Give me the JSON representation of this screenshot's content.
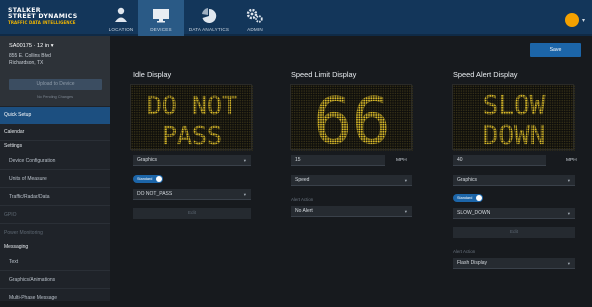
{
  "header": {
    "logo_line1": "STALKER",
    "logo_line2": "STREET DYNAMICS",
    "logo_line3": "TRAFFIC DATA INTELLIGENCE",
    "nav": [
      {
        "label": "LOCATION",
        "icon": "person-location-icon"
      },
      {
        "label": "DEVICES",
        "icon": "monitor-icon",
        "active": true
      },
      {
        "label": "DATA ANALYTICS",
        "icon": "pie-chart-icon"
      },
      {
        "label": "ADMIN",
        "icon": "gears-icon"
      }
    ]
  },
  "sidebar": {
    "device_id": "SA00175 · 12 in",
    "device_caret": "▾",
    "address_line1": "855 E. Collins Blvd",
    "address_line2": "Richardson, TX",
    "upload_label": "Upload to Device",
    "pending_label": "No Pending Changes",
    "items": [
      {
        "label": "Quick Setup",
        "type": "active"
      },
      {
        "label": "Calendar",
        "type": "section"
      },
      {
        "label": "Settings",
        "type": "section"
      },
      {
        "label": "Device Configuration",
        "type": "sub"
      },
      {
        "label": "Units of Measure",
        "type": "sub"
      },
      {
        "label": "Traffic/Radar/Data",
        "type": "sub"
      },
      {
        "label": "GPIO",
        "type": "dim"
      },
      {
        "label": "Power Monitoring",
        "type": "dim"
      },
      {
        "label": "Messaging",
        "type": "section"
      },
      {
        "label": "Text",
        "type": "sub"
      },
      {
        "label": "Graphics/Animations",
        "type": "sub"
      },
      {
        "label": "Multi-Phase Message",
        "type": "sub"
      }
    ]
  },
  "main": {
    "save_label": "Save",
    "idle": {
      "title": "Idle Display",
      "led_line1": "DO NOT",
      "led_line2": "PASS",
      "mode": "Graphics",
      "toggle_label": "Standard",
      "graphic": "DO NOT_PASS",
      "edit_label": "Edit"
    },
    "speed_limit": {
      "title": "Speed Limit Display",
      "led_text": "66",
      "value": "15",
      "unit": "MPH",
      "mode": "Speed",
      "alert_label": "Alert Action",
      "alert_value": "No Alert"
    },
    "speed_alert": {
      "title": "Speed Alert Display",
      "led_line1": "SLOW",
      "led_line2": "DOWN",
      "value": "40",
      "unit": "MPH",
      "mode": "Graphics",
      "toggle_label": "Standard",
      "graphic": "SLOW_DOWN",
      "edit_label": "Edit",
      "alert_label": "Alert Action",
      "alert_value": "Flash Display"
    },
    "led_color": "#e3c22a",
    "led_dim": "#3a3418"
  }
}
